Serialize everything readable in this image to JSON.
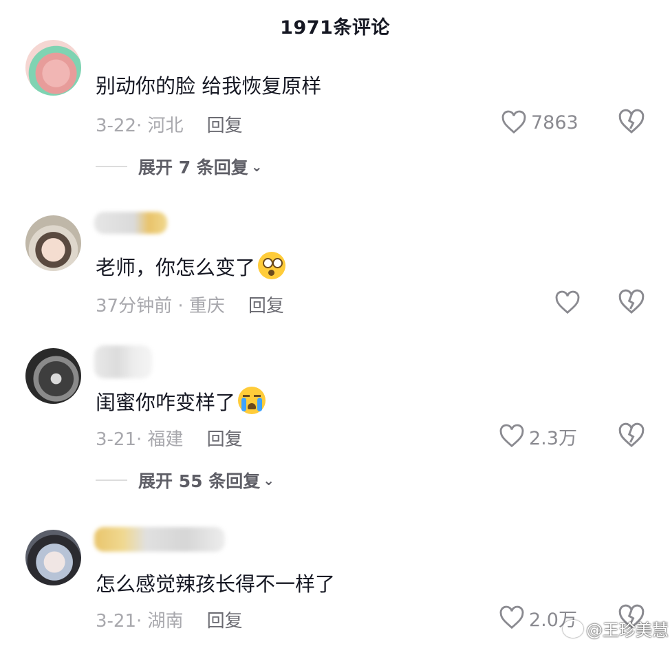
{
  "header": {
    "title": "1971条评论"
  },
  "comments": [
    {
      "text": "别动你的脸 给我恢复原样",
      "date": "3-22",
      "location": "河北",
      "reply_label": "回复",
      "likes": "7863",
      "expand_label": "展开 7 条回复"
    },
    {
      "text": "老师，你怎么变了",
      "date": "37分钟前",
      "location": "重庆",
      "reply_label": "回复",
      "likes": ""
    },
    {
      "text": "闺蜜你咋变样了",
      "date": "3-21",
      "location": "福建",
      "reply_label": "回复",
      "likes": "2.3万",
      "expand_label": "展开 55 条回复"
    },
    {
      "text": "怎么感觉辣孩长得不一样了",
      "date": "3-21",
      "location": "湖南",
      "reply_label": "回复",
      "likes": "2.0万"
    }
  ],
  "watermark": {
    "text": "@王珍美慧"
  },
  "colors": {
    "text": "#161823",
    "meta": "#a8a8ad",
    "reply": "#6b6b72",
    "expand": "#5e5e66"
  },
  "icons": {
    "like": "heart-outline-icon",
    "dislike": "broken-heart-icon",
    "expand": "chevron-down-icon"
  }
}
